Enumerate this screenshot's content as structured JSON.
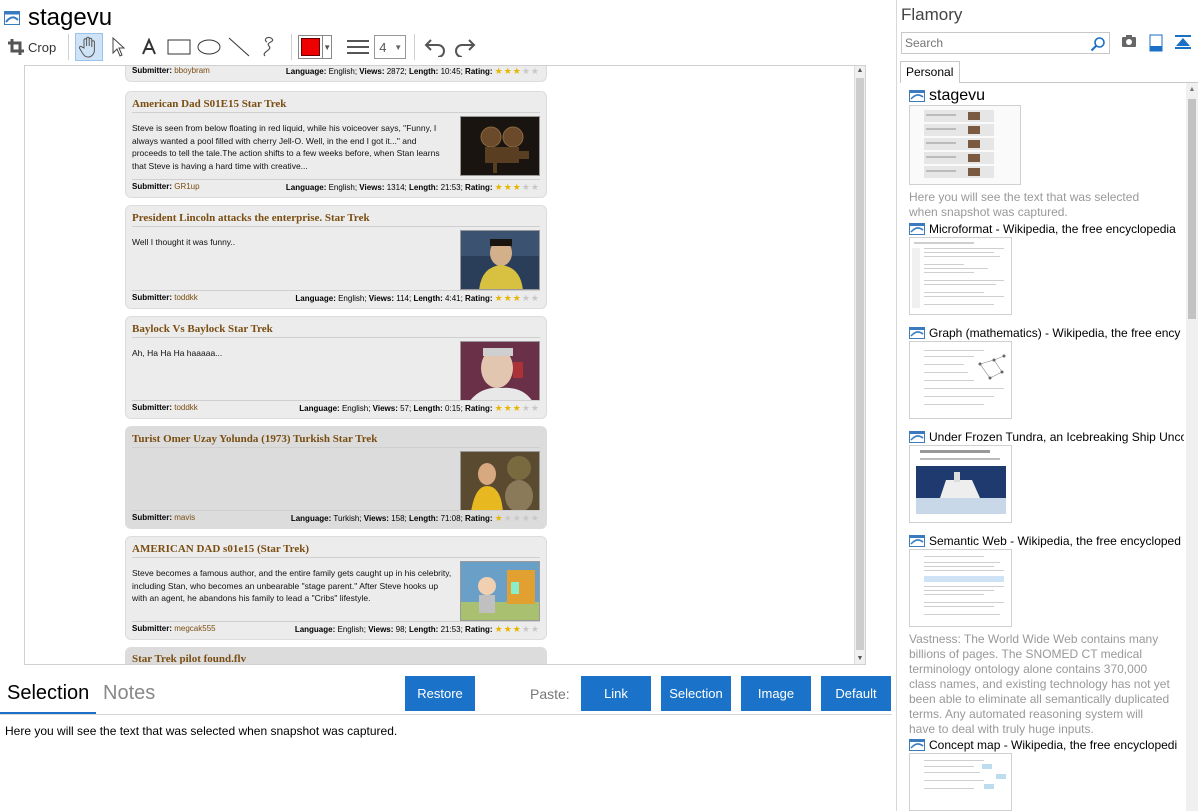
{
  "window": {
    "title": "stagevu"
  },
  "toolbar": {
    "crop_label": "Crop",
    "line_width": "4",
    "draw_color": "#ee0000"
  },
  "cards": [
    {
      "title": "",
      "desc": "",
      "submitter_label": "Submitter:",
      "submitter": "bboybram",
      "meta_html_parts": {
        "lang_label": "Language:",
        "lang": "English;",
        "views_label": "Views:",
        "views": "2872;",
        "length_label": "Length:",
        "length": "10:45;",
        "rating_label": "Rating:"
      },
      "rating": 3
    },
    {
      "title": "American Dad S01E15 Star Trek",
      "desc": "Steve is seen from below floating in red liquid, while his voiceover says, \"Funny, I always wanted a pool filled with cherry Jell-O. Well, in the end I got it...\" and proceeds to tell the tale.The action shifts to a few weeks before, when Stan learns that Steve is having a hard time with creative...",
      "submitter_label": "Submitter:",
      "submitter": "GR1up",
      "meta_html_parts": {
        "lang_label": "Language:",
        "lang": "English;",
        "views_label": "Views:",
        "views": "1314;",
        "length_label": "Length:",
        "length": "21:53;",
        "rating_label": "Rating:"
      },
      "rating": 3
    },
    {
      "title": "President Lincoln attacks the enterprise. Star Trek",
      "desc": "Well I thought it was funny..",
      "submitter_label": "Submitter:",
      "submitter": "toddkk",
      "meta_html_parts": {
        "lang_label": "Language:",
        "lang": "English;",
        "views_label": "Views:",
        "views": "114;",
        "length_label": "Length:",
        "length": "4:41;",
        "rating_label": "Rating:"
      },
      "rating": 3
    },
    {
      "title": "Baylock Vs Baylock Star Trek",
      "desc": "Ah, Ha Ha Ha haaaaa...",
      "submitter_label": "Submitter:",
      "submitter": "toddkk",
      "meta_html_parts": {
        "lang_label": "Language:",
        "lang": "English;",
        "views_label": "Views:",
        "views": "57;",
        "length_label": "Length:",
        "length": "0:15;",
        "rating_label": "Rating:"
      },
      "rating": 3
    },
    {
      "title": "Turist Omer Uzay Yolunda (1973) Turkish Star Trek",
      "desc": "",
      "submitter_label": "Submitter:",
      "submitter": "mavis",
      "meta_html_parts": {
        "lang_label": "Language:",
        "lang": "Turkish;",
        "views_label": "Views:",
        "views": "158;",
        "length_label": "Length:",
        "length": "71:08;",
        "rating_label": "Rating:"
      },
      "rating": 1
    },
    {
      "title": "AMERICAN DAD s01e15 (Star Trek)",
      "desc": "Steve becomes a famous author, and the entire family gets caught up in his celebrity, including Stan, who becomes an unbearable \"stage parent.\" After Steve hooks up with an agent, he abandons his family to lead a \"Cribs\" lifestyle.",
      "submitter_label": "Submitter:",
      "submitter": "megcak555",
      "meta_html_parts": {
        "lang_label": "Language:",
        "lang": "English;",
        "views_label": "Views:",
        "views": "98;",
        "length_label": "Length:",
        "length": "21:53;",
        "rating_label": "Rating:"
      },
      "rating": 3
    },
    {
      "title": "Star Trek pilot found.flv"
    }
  ],
  "bottom": {
    "tab_selection": "Selection",
    "tab_notes": "Notes",
    "restore": "Restore",
    "paste_label": "Paste:",
    "link": "Link",
    "selection": "Selection",
    "image": "Image",
    "default": "Default",
    "selection_text": "Here you will see the text that was selected when snapshot was captured."
  },
  "sidebar": {
    "brand": "Flamory",
    "search_placeholder": "Search",
    "tab_personal": "Personal",
    "entries": [
      {
        "title": "stagevu",
        "desc": "Here you will see the text that was selected when snapshot was captured."
      },
      {
        "title": "Microformat - Wikipedia, the free encyclopedia",
        "desc": ""
      },
      {
        "title": "Graph (mathematics) - Wikipedia, the free ency",
        "desc": ""
      },
      {
        "title": "Under Frozen Tundra, an Icebreaking Ship Unco",
        "desc": ""
      },
      {
        "title": "Semantic Web - Wikipedia, the free encycloped",
        "desc": "Vastness: The World Wide Web contains many billions of pages. The SNOMED CT medical terminology ontology alone contains 370,000 class names, and existing technology has not yet been able to eliminate all semantically duplicated terms. Any automated reasoning system will have to deal with truly huge inputs."
      },
      {
        "title": "Concept map - Wikipedia, the free encyclopedi",
        "desc": ""
      }
    ]
  },
  "colors": {
    "accent": "#1a73c9",
    "title_brown": "#7a4e12",
    "star": "#e7b600",
    "card_bg": "#ececec"
  }
}
